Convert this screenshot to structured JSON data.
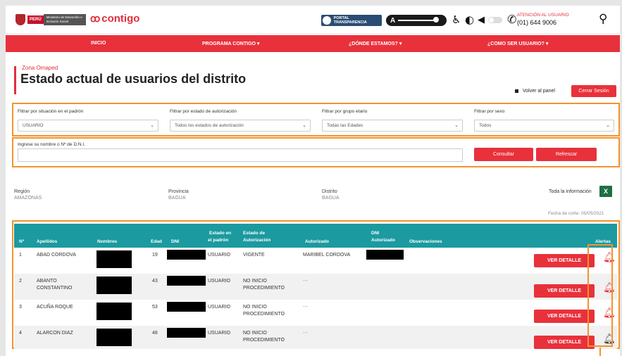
{
  "header": {
    "ministry_badge": "PERÚ",
    "ministry_name": "Ministerio de Desarrollo e Inclusión Social",
    "brand": "contigo",
    "portal_label": "PORTAL TRANSPARENCIA",
    "zoom_label": "A",
    "phone_label": "ATENCIÓN AL USUARIO",
    "phone_number": "(01) 644 9006"
  },
  "nav": {
    "items": [
      {
        "label": "INICIO"
      },
      {
        "label": "PROGRAMA CONTIGO ▾"
      },
      {
        "label": "¿DÓNDE ESTAMOS? ▾"
      },
      {
        "label": "¿COMO SER USUARIO? ▾"
      }
    ]
  },
  "page": {
    "subtitle": "Zona Omaped",
    "title": "Estado actual de usuarios del distrito",
    "back_label": "Volver al panel",
    "logout_label": "Cerrar Sesión"
  },
  "filters": [
    {
      "label": "Filtrar por situación en el padrón",
      "value": "USUARIO"
    },
    {
      "label": "Filtrar por estado de autorización",
      "value": "Todos los estados de autorización"
    },
    {
      "label": "Filtrar por grupo etario",
      "value": "Todas las Edades"
    },
    {
      "label": "Filtrar por sexo",
      "value": "Todos"
    }
  ],
  "search": {
    "label": "Ingrese su nombre o Nº de D.N.I.",
    "value": "",
    "consult_label": "Consultar",
    "refresh_label": "Refrescar"
  },
  "location": {
    "region_label": "Región",
    "region_value": "AMAZONAS",
    "province_label": "Provincia",
    "province_value": "BAGUA",
    "district_label": "Distrito",
    "district_value": "BAGUA",
    "all_info_label": "Toda la información",
    "cutoff_date": "Fecha de corte: 05/05/2021"
  },
  "table": {
    "headers": {
      "num": "Nº",
      "surnames": "Apellidos",
      "names": "Nombres",
      "age": "Edad",
      "dni": "DNI",
      "status_line1": "Estado en",
      "status_line2": "el padrón",
      "auth_line1": "Estado de",
      "auth_line2": "Autorización",
      "authorized": "Autorizado",
      "dni_auth_line1": "DNI",
      "dni_auth_line2": "Autorizado",
      "observations": "Observaciones",
      "alerts": "Alertas"
    },
    "detail_label": "VER DETALLE",
    "rows": [
      {
        "num": "1",
        "surnames": "ABAD CORDOVA",
        "age": "19",
        "status": "USUARIO",
        "auth": "VIGENTE",
        "authorized": "MARIBEL CORDOVA",
        "alert_color": "#e8313b"
      },
      {
        "num": "2",
        "surnames": "ABANTO CONSTANTINO",
        "age": "43",
        "status": "USUARIO",
        "auth": "NO INICIO PROCEDIMIENTO",
        "authorized": "---",
        "alert_color": "#e8313b"
      },
      {
        "num": "3",
        "surnames": "ACUÑA ROQUE",
        "age": "53",
        "status": "USUARIO",
        "auth": "NO INICIO PROCEDIMIENTO",
        "authorized": "---",
        "alert_color": "#e8313b"
      },
      {
        "num": "4",
        "surnames": "ALARCON DIAZ",
        "age": "48",
        "status": "USUARIO",
        "auth": "NO INICIO PROCEDIMIENTO",
        "authorized": "---",
        "alert_color": "#444444"
      }
    ]
  }
}
